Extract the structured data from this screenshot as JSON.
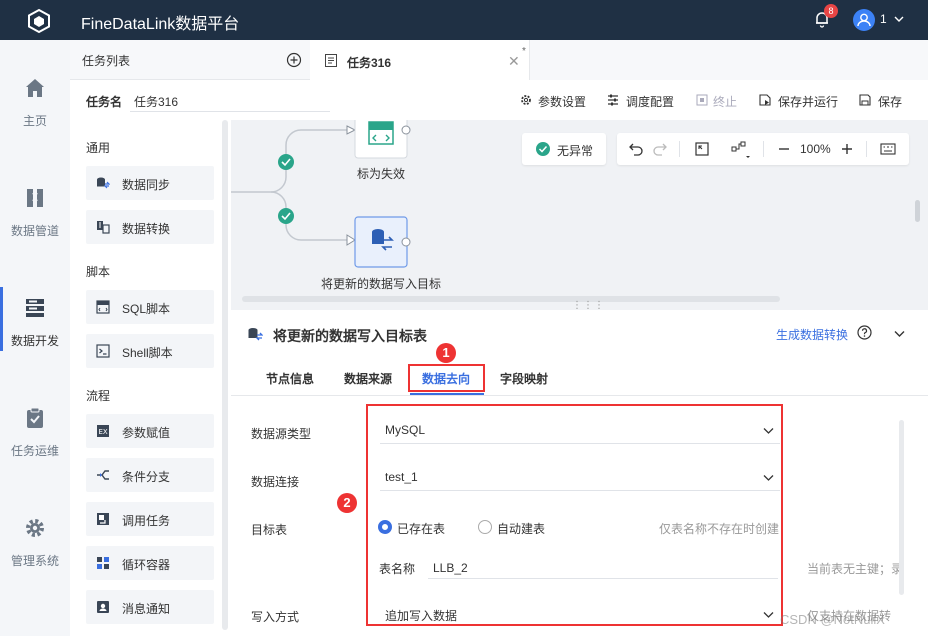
{
  "topbar": {
    "title": "FineDataLink数据平台",
    "notification_count": "8",
    "user": "1"
  },
  "leftnav": [
    {
      "label": "主页",
      "icon": "home-icon"
    },
    {
      "label": "数据管道",
      "icon": "pipeline-icon"
    },
    {
      "label": "数据开发",
      "icon": "dev-icon",
      "active": true
    },
    {
      "label": "任务运维",
      "icon": "ops-icon"
    },
    {
      "label": "管理系统",
      "icon": "gear-icon"
    }
  ],
  "tasklist": {
    "title": "任务列表"
  },
  "editor_tab": {
    "name": "任务316",
    "modified_mark": "*"
  },
  "taskname": {
    "label": "任务名",
    "value": "任务316"
  },
  "toolbar": {
    "params": "参数设置",
    "schedule": "调度配置",
    "stop": "终止",
    "save_run": "保存并运行",
    "save": "保存"
  },
  "library": {
    "sections": [
      {
        "title": "通用",
        "items": [
          "数据同步",
          "数据转换"
        ]
      },
      {
        "title": "脚本",
        "items": [
          "SQL脚本",
          "Shell脚本"
        ]
      },
      {
        "title": "流程",
        "items": [
          "参数赋值",
          "条件分支",
          "调用任务",
          "循环容器",
          "消息通知"
        ]
      }
    ]
  },
  "canvas": {
    "status": "无异常",
    "zoom": "100%",
    "nodes": [
      {
        "label": "标为失效",
        "icon_text": "SQL"
      },
      {
        "label": "将更新的数据写入目标"
      }
    ]
  },
  "detail": {
    "title": "将更新的数据写入目标表",
    "gen_link": "生成数据转换",
    "tabs": [
      "节点信息",
      "数据来源",
      "数据去向",
      "字段映射"
    ],
    "active_tab": "数据去向",
    "fields": {
      "source_type_label": "数据源类型",
      "source_type_value": "MySQL",
      "connection_label": "数据连接",
      "connection_value": "test_1",
      "target_label": "目标表",
      "radio_existing": "已存在表",
      "radio_auto": "自动建表",
      "hint_auto": "仅表名称不存在时创建",
      "table_name_label": "表名称",
      "table_name_value": "LLB_2",
      "hint_pk": "当前表无主键；录",
      "write_mode_label": "写入方式",
      "write_mode_value": "追加写入数据",
      "hint_write": "仅支持在数据转"
    },
    "callouts": [
      "1",
      "2"
    ]
  },
  "watermark": "CSDN @NotNullX"
}
